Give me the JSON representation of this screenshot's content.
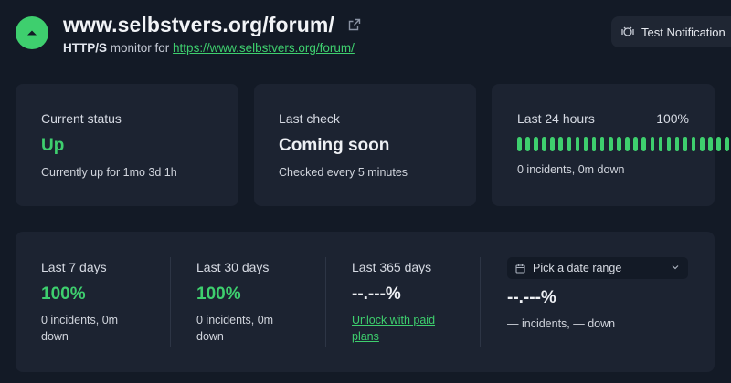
{
  "header": {
    "title": "www.selbstvers.org/forum/",
    "protocol": "HTTP/S",
    "monitor_for": " monitor for ",
    "url": "https://www.selbstvers.org/forum/",
    "status_icon": "chevron-up-icon",
    "external_icon": "external-link-icon"
  },
  "actions": {
    "test_notification": "Test Notification"
  },
  "current_status": {
    "label": "Current status",
    "value": "Up",
    "detail": "Currently up for 1mo 3d 1h"
  },
  "last_check": {
    "label": "Last check",
    "value": "Coming soon",
    "detail": "Checked every 5 minutes"
  },
  "last_24h": {
    "label": "Last 24 hours",
    "percent": "100%",
    "bar_count": 30,
    "detail": "0 incidents, 0m down"
  },
  "periods": [
    {
      "label": "Last 7 days",
      "value": "100%",
      "detail": "0 incidents, 0m down"
    },
    {
      "label": "Last 30 days",
      "value": "100%",
      "detail": "0 incidents, 0m down"
    },
    {
      "label": "Last 365 days",
      "value": "--.---%",
      "link": "Unlock with paid plans"
    }
  ],
  "custom_range": {
    "select_label": "Pick a date range",
    "value": "--.---%",
    "detail": "— incidents, — down"
  },
  "colors": {
    "accent": "#3ecf6e",
    "background": "#131a26",
    "card": "#1c2331"
  }
}
